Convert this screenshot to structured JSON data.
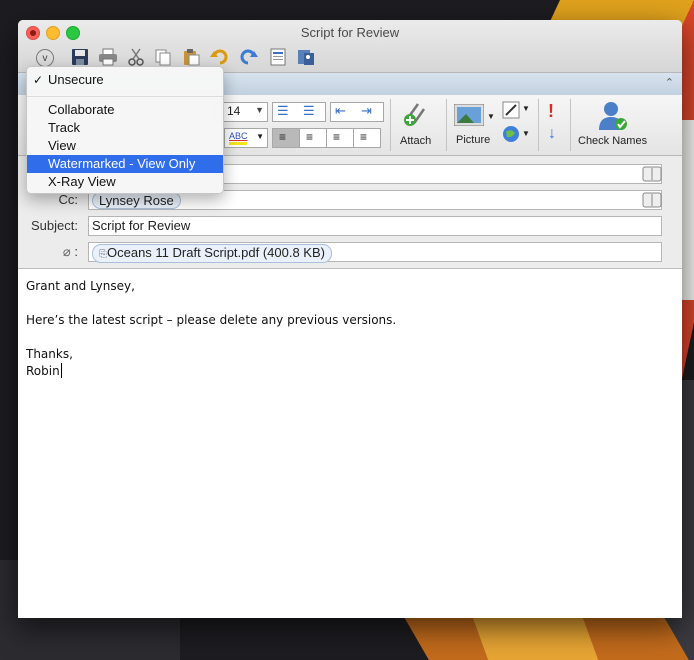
{
  "window": {
    "title": "Script for Review"
  },
  "toolbar": {
    "icons": [
      "options-icon",
      "save-icon",
      "print-icon",
      "cut-icon",
      "copy-icon",
      "paste-icon",
      "undo-icon",
      "redo-icon",
      "format-icon",
      "address-book-icon"
    ]
  },
  "ribbon": {
    "font_size": "14",
    "attach_label": "Attach",
    "picture_label": "Picture",
    "check_names_label": "Check Names",
    "spell_label": "ABC"
  },
  "headers": {
    "cc_label": "Cc:",
    "cc_recipient": "Lynsey Rose",
    "subject_label": "Subject:",
    "subject_value": "Script for Review",
    "attachment_label": ":",
    "attachment_name": "Oceans 11 Draft Script.pdf (400.8 KB)"
  },
  "body": {
    "lines": [
      "Grant and Lynsey,",
      "Here’s the latest script – please delete any previous versions.",
      "Thanks,",
      "Robin"
    ]
  },
  "menu": {
    "check_mark": "✓",
    "items": [
      "Unsecure",
      "Collaborate",
      "Track",
      "View",
      "Watermarked - View Only",
      "X-Ray View"
    ],
    "checked_index": 0,
    "selected_index": 4
  },
  "colors": {
    "selection": "#2f6dea",
    "token_border": "#a9c0dc",
    "ribbon_tab": "#c2d1e0"
  }
}
